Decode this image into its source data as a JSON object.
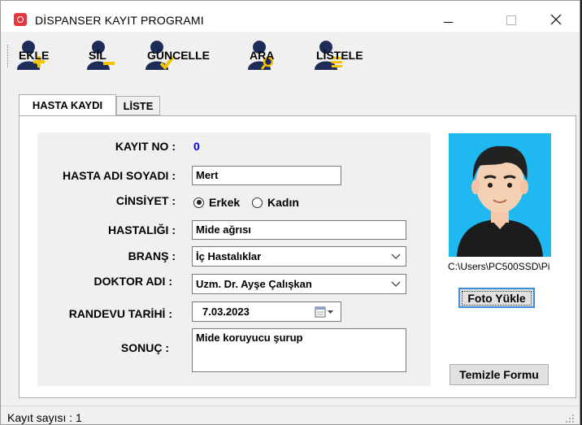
{
  "window": {
    "title": "DİSPANSER KAYIT PROGRAMI"
  },
  "toolbar": {
    "ekle": "EKLE",
    "sil": "SİL",
    "guncelle": "GÜNCELLE",
    "ara": "ARA",
    "listele": "LİSTELE"
  },
  "tabs": [
    {
      "label": "HASTA KAYDI"
    },
    {
      "label": "LİSTE"
    }
  ],
  "form": {
    "kayit_no_label": "KAYIT NO :",
    "kayit_no_value": "0",
    "hasta_adi_label": "HASTA ADI SOYADI :",
    "hasta_adi_value": "Mert",
    "cinsiyet_label": "CİNSİYET :",
    "cinsiyet_options": [
      {
        "label": "Erkek",
        "selected": true
      },
      {
        "label": "Kadın",
        "selected": false
      }
    ],
    "hastalik_label": "HASTALIĞI :",
    "hastalik_value": "Mide ağrısı",
    "brans_label": "BRANŞ :",
    "brans_value": "İç Hastalıklar",
    "doktor_label": "DOKTOR ADI :",
    "doktor_value": "Uzm. Dr. Ayşe Çalışkan",
    "randevu_label": "RANDEVU TARİHİ :",
    "randevu_value": "7.03.2023",
    "sonuc_label": "SONUÇ :",
    "sonuc_value": "Mide koruyucu şurup"
  },
  "photo": {
    "path": "C:\\Users\\PC500SSD\\Pi",
    "upload_label": "Foto Yükle",
    "clear_label": "Temizle Formu"
  },
  "status": {
    "text": "Kayıt sayısı : 1"
  },
  "colors": {
    "accent_blue": "#0000ee",
    "photo_bg": "#1fb8f0",
    "user_icon": "#1e2c5a",
    "icon_add": "#f5c400"
  }
}
